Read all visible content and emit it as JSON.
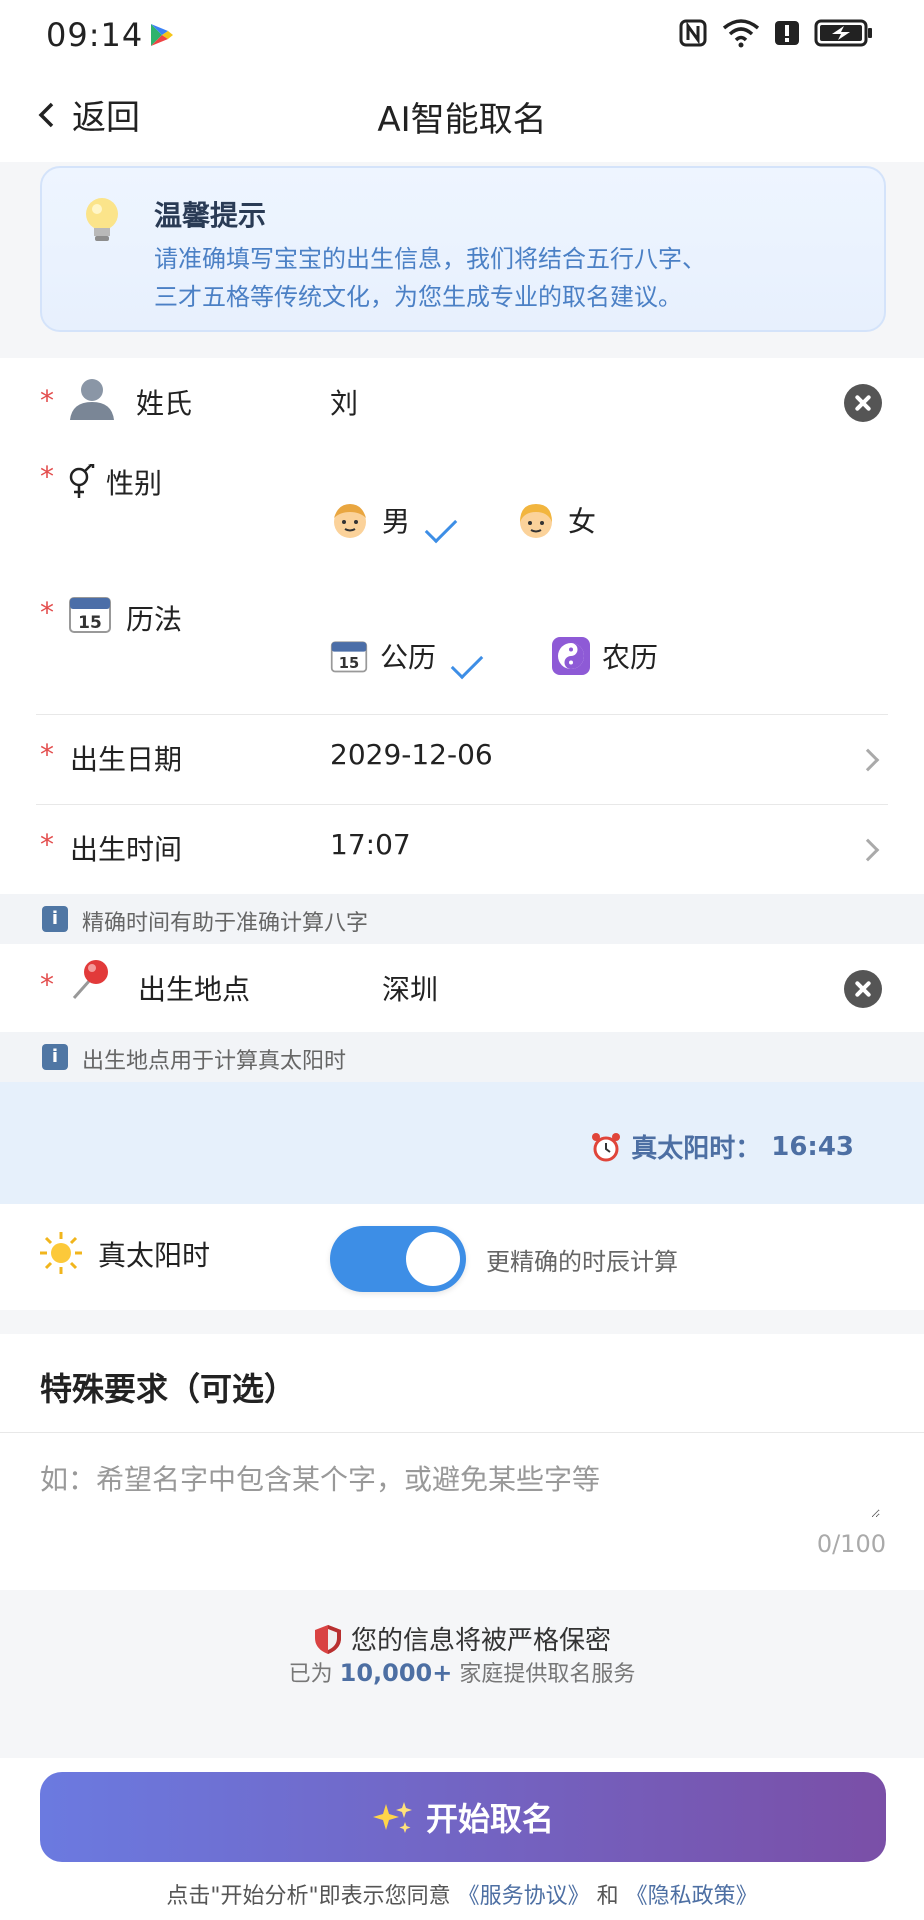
{
  "status": {
    "time": "09:14"
  },
  "nav": {
    "back_label": "返回",
    "title": "AI智能取名"
  },
  "tip": {
    "title": "温馨提示",
    "line1": "请准确填写宝宝的出生信息，我们将结合五行八字、",
    "line2": "三才五格等传统文化，为您生成专业的取名建议。"
  },
  "form": {
    "required_mark": "*",
    "surname": {
      "label": "姓氏",
      "value": "刘"
    },
    "gender": {
      "label": "性别",
      "options": [
        "男",
        "女"
      ],
      "selected": "男"
    },
    "calendar": {
      "label": "历法",
      "options": [
        "公历",
        "农历"
      ],
      "selected": "公历"
    },
    "birth_date": {
      "label": "出生日期",
      "value": "2029-12-06"
    },
    "birth_time": {
      "label": "出生时间",
      "value": "17:07"
    },
    "time_hint": "精确时间有助于准确计算八字",
    "birth_place": {
      "label": "出生地点",
      "value": "深圳"
    },
    "place_hint": "出生地点用于计算真太阳时",
    "info_icon": "i"
  },
  "solar": {
    "readout_label": "真太阳时：",
    "readout_value": "16:43",
    "toggle_label": "真太阳时",
    "toggle_desc": "更精确的时辰计算",
    "enabled": true
  },
  "special": {
    "title": "特殊要求（可选）",
    "placeholder": "如：希望名字中包含某个字，或避免某些字等",
    "count": "0/100"
  },
  "privacy": {
    "line1": "您的信息将被严格保密",
    "line2_prefix": "已为",
    "line2_count": "10,000+",
    "line2_suffix": "家庭提供取名服务"
  },
  "cta": {
    "label": "开始取名",
    "agree_prefix": "点击\"开始分析\"即表示您同意",
    "service_link": "《服务协议》",
    "and": "和",
    "privacy_link": "《隐私政策》"
  },
  "colors": {
    "accent": "#3d8ee6",
    "required": "#e34d4d",
    "cta_start": "#6b7ae0",
    "cta_end": "#7a4fa7"
  }
}
